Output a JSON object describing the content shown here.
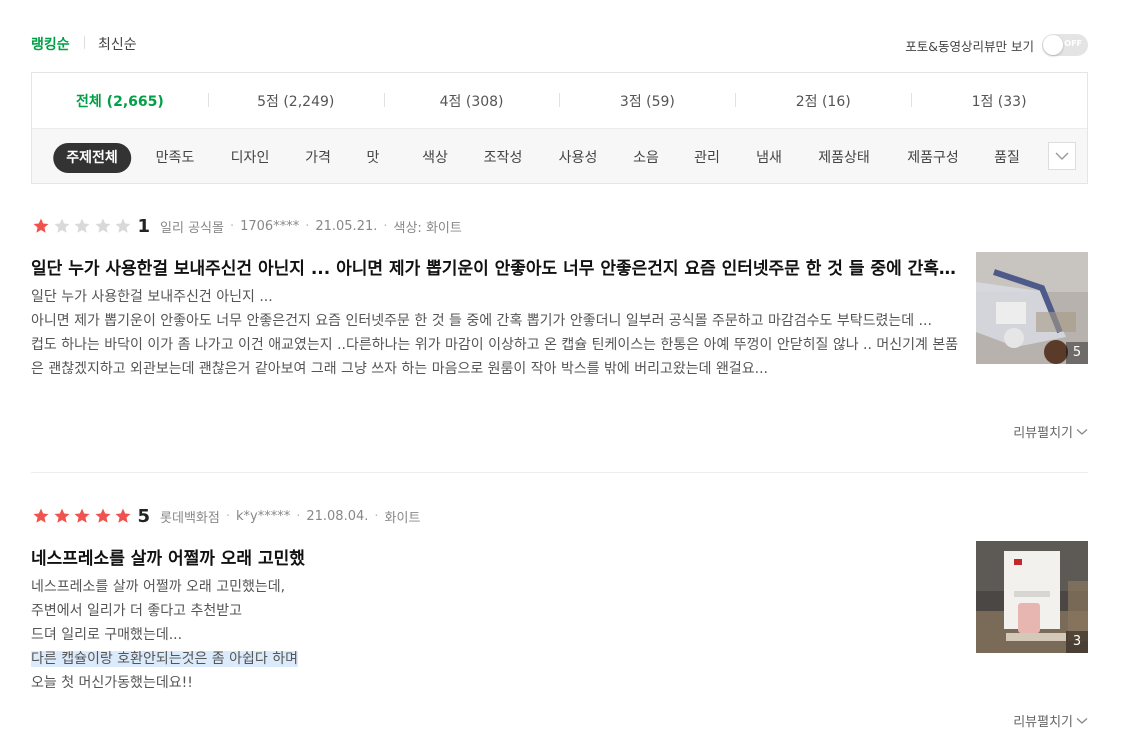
{
  "sort": {
    "active": "랭킹순",
    "other": "최신순",
    "photo_filter_label": "포토&동영상리뷰만 보기",
    "toggle_text": "OFF"
  },
  "score_tabs": [
    {
      "label": "전체 (2,665)",
      "active": true
    },
    {
      "label": "5점 (2,249)",
      "active": false
    },
    {
      "label": "4점 (308)",
      "active": false
    },
    {
      "label": "3점 (59)",
      "active": false
    },
    {
      "label": "2점 (16)",
      "active": false
    },
    {
      "label": "1점 (33)",
      "active": false
    }
  ],
  "topics": [
    "주제전체",
    "만족도",
    "디자인",
    "가격",
    "맛",
    "색상",
    "조작성",
    "사용성",
    "소음",
    "관리",
    "냄새",
    "제품상태",
    "제품구성",
    "품질"
  ],
  "colors": {
    "accent": "#00a046",
    "star_on": "#f0524d",
    "star_off": "#d9d9d9"
  },
  "reviews": [
    {
      "rating": 1,
      "score": "1",
      "store": "일리 공식몰",
      "user": "1706****",
      "date": "21.05.21.",
      "option": "색상: 화이트",
      "title": "일단 누가 사용한걸 보내주신건 아닌지 ... 아니면 제가 뽑기운이 안좋아도 너무 안좋은건지 요즘 인터넷주문 한 것 들 중에 간혹 뽑기가 안좋더니",
      "body": [
        "일단 누가 사용한걸 보내주신건 아닌지 ...",
        "아니면 제가 뽑기운이 안좋아도 너무 안좋은건지 요즘 인터넷주문 한 것 들 중에 간혹 뽑기가 안좋더니 일부러 공식몰 주문하고 마감검수도 부탁드렸는데 ...",
        "컵도 하나는 바닥이 이가 좀 나가고 이건 애교였는지 ..다른하나는 위가 마감이 이상하고 온 캡슐 틴케이스는 한통은 아예 뚜껑이 안닫히질 않나 .. 머신기계 본품은 괜찮겠지하고 외관보는데 괜찮은거 같아보여 그래 그냥 쓰자 하는 마음으로 원룸이 작아 박스를 밖에 버리고왔는데 왠걸요..."
      ],
      "photo_count": "5",
      "expand_label": "리뷰펼치기"
    },
    {
      "rating": 5,
      "score": "5",
      "store": "롯데백화점",
      "user": "k*y*****",
      "date": "21.08.04.",
      "option": "화이트",
      "title": "네스프레소를 살까 어쩔까 오래 고민했",
      "body": [
        "네스프레소를 살까 어쩔까 오래 고민했는데,",
        "주변에서 일리가 더 좋다고 추천받고",
        "드뎌 일리로 구매했는데...",
        "다른 캡슐이랑 호환안되는것은 좀 아쉽다 하며",
        "오늘 첫 머신가동했는데요!!"
      ],
      "photo_count": "3",
      "expand_label": "리뷰펼치기"
    }
  ]
}
